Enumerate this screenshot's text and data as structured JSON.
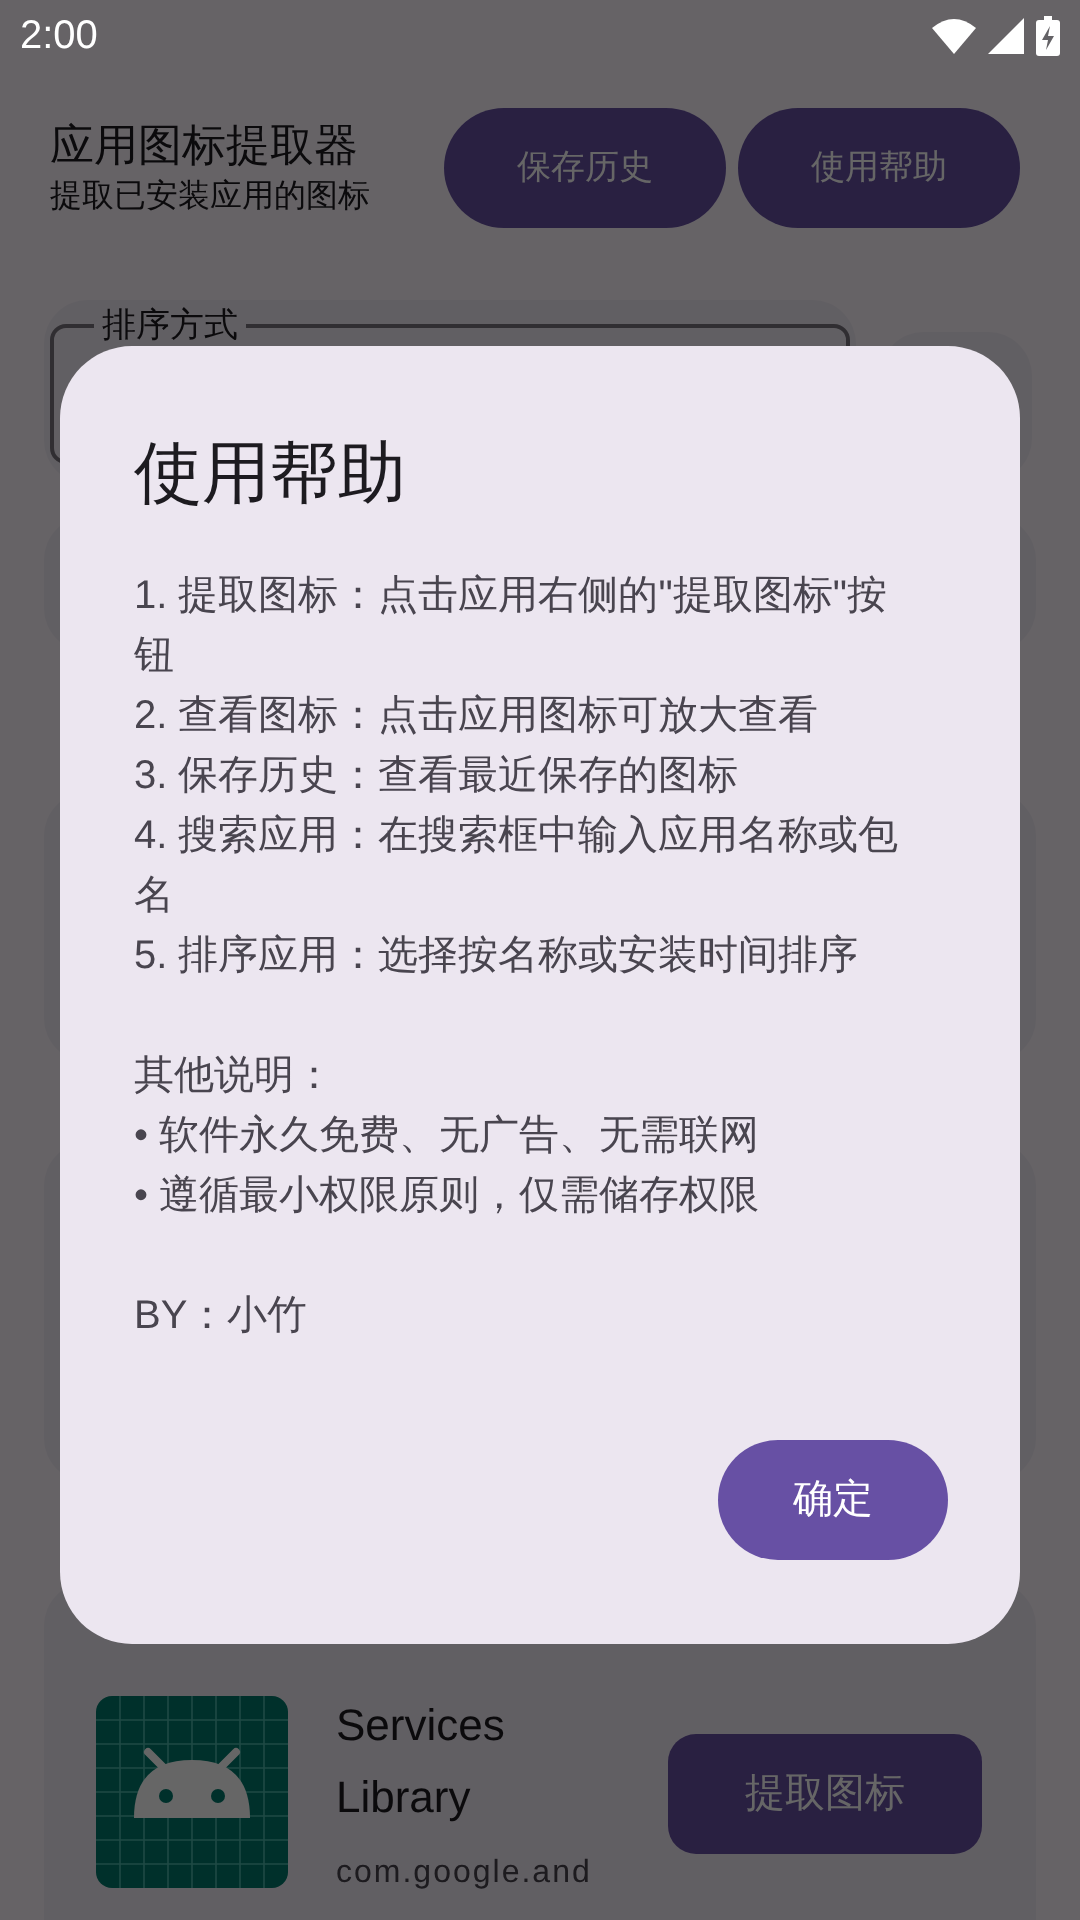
{
  "status_bar": {
    "time": "2:00"
  },
  "header": {
    "title": "应用图标提取器",
    "subtitle": "提取已安装应用的图标",
    "buttons": [
      "保存历史",
      "使用帮助"
    ]
  },
  "sort_field": {
    "label": "排序方式"
  },
  "app_card": {
    "name": "Services Library",
    "package": "com.google.and",
    "button": "提取图标"
  },
  "dialog": {
    "title": "使用帮助",
    "sections": [
      [
        "1. 提取图标：点击应用右侧的\"提取图标\"按钮",
        "2. 查看图标：点击应用图标可放大查看",
        "3. 保存历史：查看最近保存的图标",
        "4. 搜索应用：在搜索框中输入应用名称或包名",
        "5. 排序应用：选择按名称或安装时间排序"
      ],
      [
        "其他说明：",
        "• 软件永久免费、无广告、无需联网",
        "• 遵循最小权限原则，仅需储存权限"
      ],
      [
        "BY：小竹"
      ]
    ],
    "button": "确定"
  }
}
